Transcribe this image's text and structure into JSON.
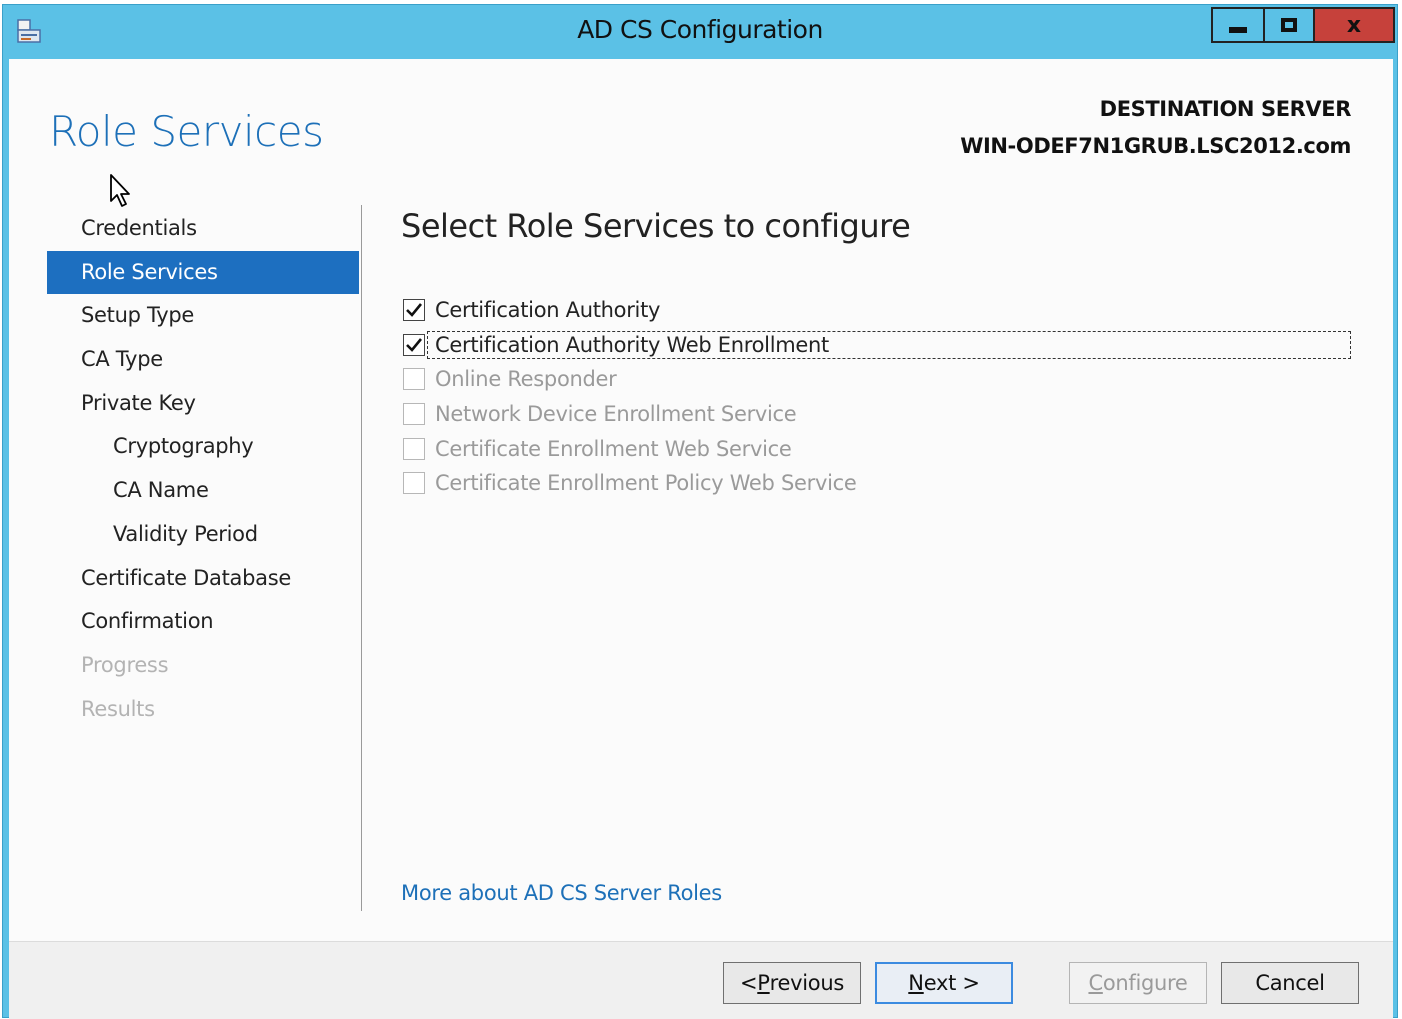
{
  "window": {
    "title": "AD CS Configuration",
    "close_glyph": "x"
  },
  "header": {
    "page_heading": "Role Services",
    "destination_label": "DESTINATION SERVER",
    "destination_server": "WIN-ODEF7N1GRUB.LSC2012.com"
  },
  "nav": {
    "items": [
      {
        "label": "Credentials",
        "state": "normal",
        "indent": 0
      },
      {
        "label": "Role Services",
        "state": "active",
        "indent": 0
      },
      {
        "label": "Setup Type",
        "state": "normal",
        "indent": 0
      },
      {
        "label": "CA Type",
        "state": "normal",
        "indent": 0
      },
      {
        "label": "Private Key",
        "state": "normal",
        "indent": 0
      },
      {
        "label": "Cryptography",
        "state": "normal",
        "indent": 1
      },
      {
        "label": "CA Name",
        "state": "normal",
        "indent": 1
      },
      {
        "label": "Validity Period",
        "state": "normal",
        "indent": 1
      },
      {
        "label": "Certificate Database",
        "state": "normal",
        "indent": 0
      },
      {
        "label": "Confirmation",
        "state": "normal",
        "indent": 0
      },
      {
        "label": "Progress",
        "state": "disabled",
        "indent": 0
      },
      {
        "label": "Results",
        "state": "disabled",
        "indent": 0
      }
    ]
  },
  "main": {
    "section_title": "Select Role Services to configure",
    "role_services": [
      {
        "label": "Certification Authority",
        "checked": true,
        "enabled": true,
        "focused": false
      },
      {
        "label": "Certification Authority Web Enrollment",
        "checked": true,
        "enabled": true,
        "focused": true
      },
      {
        "label": "Online Responder",
        "checked": false,
        "enabled": false,
        "focused": false
      },
      {
        "label": "Network Device Enrollment Service",
        "checked": false,
        "enabled": false,
        "focused": false
      },
      {
        "label": "Certificate Enrollment Web Service",
        "checked": false,
        "enabled": false,
        "focused": false
      },
      {
        "label": "Certificate Enrollment Policy Web Service",
        "checked": false,
        "enabled": false,
        "focused": false
      }
    ],
    "more_link": "More about AD CS Server Roles"
  },
  "footer": {
    "previous": {
      "label": "< Previous",
      "accesskey": "P"
    },
    "next": {
      "label": "Next >",
      "accesskey": "N"
    },
    "configure": {
      "label": "Configure",
      "accesskey": "C"
    },
    "cancel": {
      "label": "Cancel"
    }
  },
  "colors": {
    "titlebar": "#5bc1e6",
    "accent": "#1d70b8",
    "nav_active_bg": "#1d6fc0",
    "close_button": "#c6413b"
  }
}
